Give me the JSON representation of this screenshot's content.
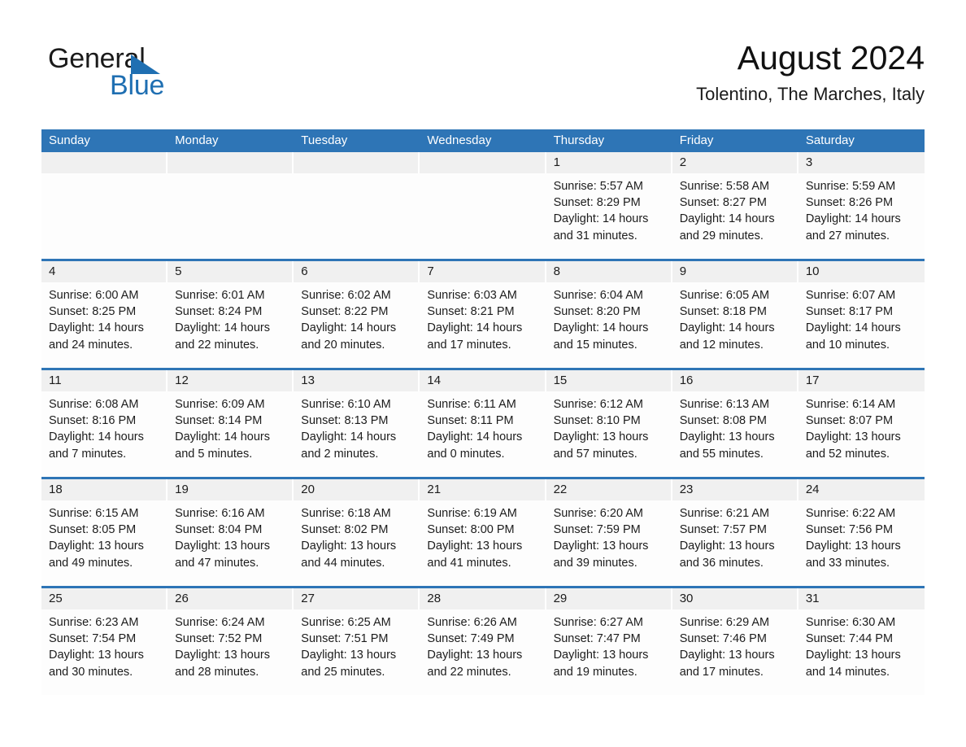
{
  "brand": {
    "name_top": "General",
    "name_bottom": "Blue",
    "accent_color": "#1f6fb2"
  },
  "header": {
    "month_title": "August 2024",
    "location": "Tolentino, The Marches, Italy"
  },
  "theme": {
    "header_blue": "#2e75b6",
    "daynum_band": "#f0f0f0",
    "text": "#1c1c1c"
  },
  "calendar": {
    "weekdays": [
      "Sunday",
      "Monday",
      "Tuesday",
      "Wednesday",
      "Thursday",
      "Friday",
      "Saturday"
    ],
    "labels": {
      "sunrise": "Sunrise:",
      "sunset": "Sunset:",
      "daylight": "Daylight:"
    },
    "weeks": [
      [
        {
          "day": "",
          "empty": true
        },
        {
          "day": "",
          "empty": true
        },
        {
          "day": "",
          "empty": true
        },
        {
          "day": "",
          "empty": true
        },
        {
          "day": "1",
          "sunrise": "Sunrise: 5:57 AM",
          "sunset": "Sunset: 8:29 PM",
          "daylight": "Daylight: 14 hours and 31 minutes."
        },
        {
          "day": "2",
          "sunrise": "Sunrise: 5:58 AM",
          "sunset": "Sunset: 8:27 PM",
          "daylight": "Daylight: 14 hours and 29 minutes."
        },
        {
          "day": "3",
          "sunrise": "Sunrise: 5:59 AM",
          "sunset": "Sunset: 8:26 PM",
          "daylight": "Daylight: 14 hours and 27 minutes."
        }
      ],
      [
        {
          "day": "4",
          "sunrise": "Sunrise: 6:00 AM",
          "sunset": "Sunset: 8:25 PM",
          "daylight": "Daylight: 14 hours and 24 minutes."
        },
        {
          "day": "5",
          "sunrise": "Sunrise: 6:01 AM",
          "sunset": "Sunset: 8:24 PM",
          "daylight": "Daylight: 14 hours and 22 minutes."
        },
        {
          "day": "6",
          "sunrise": "Sunrise: 6:02 AM",
          "sunset": "Sunset: 8:22 PM",
          "daylight": "Daylight: 14 hours and 20 minutes."
        },
        {
          "day": "7",
          "sunrise": "Sunrise: 6:03 AM",
          "sunset": "Sunset: 8:21 PM",
          "daylight": "Daylight: 14 hours and 17 minutes."
        },
        {
          "day": "8",
          "sunrise": "Sunrise: 6:04 AM",
          "sunset": "Sunset: 8:20 PM",
          "daylight": "Daylight: 14 hours and 15 minutes."
        },
        {
          "day": "9",
          "sunrise": "Sunrise: 6:05 AM",
          "sunset": "Sunset: 8:18 PM",
          "daylight": "Daylight: 14 hours and 12 minutes."
        },
        {
          "day": "10",
          "sunrise": "Sunrise: 6:07 AM",
          "sunset": "Sunset: 8:17 PM",
          "daylight": "Daylight: 14 hours and 10 minutes."
        }
      ],
      [
        {
          "day": "11",
          "sunrise": "Sunrise: 6:08 AM",
          "sunset": "Sunset: 8:16 PM",
          "daylight": "Daylight: 14 hours and 7 minutes."
        },
        {
          "day": "12",
          "sunrise": "Sunrise: 6:09 AM",
          "sunset": "Sunset: 8:14 PM",
          "daylight": "Daylight: 14 hours and 5 minutes."
        },
        {
          "day": "13",
          "sunrise": "Sunrise: 6:10 AM",
          "sunset": "Sunset: 8:13 PM",
          "daylight": "Daylight: 14 hours and 2 minutes."
        },
        {
          "day": "14",
          "sunrise": "Sunrise: 6:11 AM",
          "sunset": "Sunset: 8:11 PM",
          "daylight": "Daylight: 14 hours and 0 minutes."
        },
        {
          "day": "15",
          "sunrise": "Sunrise: 6:12 AM",
          "sunset": "Sunset: 8:10 PM",
          "daylight": "Daylight: 13 hours and 57 minutes."
        },
        {
          "day": "16",
          "sunrise": "Sunrise: 6:13 AM",
          "sunset": "Sunset: 8:08 PM",
          "daylight": "Daylight: 13 hours and 55 minutes."
        },
        {
          "day": "17",
          "sunrise": "Sunrise: 6:14 AM",
          "sunset": "Sunset: 8:07 PM",
          "daylight": "Daylight: 13 hours and 52 minutes."
        }
      ],
      [
        {
          "day": "18",
          "sunrise": "Sunrise: 6:15 AM",
          "sunset": "Sunset: 8:05 PM",
          "daylight": "Daylight: 13 hours and 49 minutes."
        },
        {
          "day": "19",
          "sunrise": "Sunrise: 6:16 AM",
          "sunset": "Sunset: 8:04 PM",
          "daylight": "Daylight: 13 hours and 47 minutes."
        },
        {
          "day": "20",
          "sunrise": "Sunrise: 6:18 AM",
          "sunset": "Sunset: 8:02 PM",
          "daylight": "Daylight: 13 hours and 44 minutes."
        },
        {
          "day": "21",
          "sunrise": "Sunrise: 6:19 AM",
          "sunset": "Sunset: 8:00 PM",
          "daylight": "Daylight: 13 hours and 41 minutes."
        },
        {
          "day": "22",
          "sunrise": "Sunrise: 6:20 AM",
          "sunset": "Sunset: 7:59 PM",
          "daylight": "Daylight: 13 hours and 39 minutes."
        },
        {
          "day": "23",
          "sunrise": "Sunrise: 6:21 AM",
          "sunset": "Sunset: 7:57 PM",
          "daylight": "Daylight: 13 hours and 36 minutes."
        },
        {
          "day": "24",
          "sunrise": "Sunrise: 6:22 AM",
          "sunset": "Sunset: 7:56 PM",
          "daylight": "Daylight: 13 hours and 33 minutes."
        }
      ],
      [
        {
          "day": "25",
          "sunrise": "Sunrise: 6:23 AM",
          "sunset": "Sunset: 7:54 PM",
          "daylight": "Daylight: 13 hours and 30 minutes."
        },
        {
          "day": "26",
          "sunrise": "Sunrise: 6:24 AM",
          "sunset": "Sunset: 7:52 PM",
          "daylight": "Daylight: 13 hours and 28 minutes."
        },
        {
          "day": "27",
          "sunrise": "Sunrise: 6:25 AM",
          "sunset": "Sunset: 7:51 PM",
          "daylight": "Daylight: 13 hours and 25 minutes."
        },
        {
          "day": "28",
          "sunrise": "Sunrise: 6:26 AM",
          "sunset": "Sunset: 7:49 PM",
          "daylight": "Daylight: 13 hours and 22 minutes."
        },
        {
          "day": "29",
          "sunrise": "Sunrise: 6:27 AM",
          "sunset": "Sunset: 7:47 PM",
          "daylight": "Daylight: 13 hours and 19 minutes."
        },
        {
          "day": "30",
          "sunrise": "Sunrise: 6:29 AM",
          "sunset": "Sunset: 7:46 PM",
          "daylight": "Daylight: 13 hours and 17 minutes."
        },
        {
          "day": "31",
          "sunrise": "Sunrise: 6:30 AM",
          "sunset": "Sunset: 7:44 PM",
          "daylight": "Daylight: 13 hours and 14 minutes."
        }
      ]
    ]
  }
}
